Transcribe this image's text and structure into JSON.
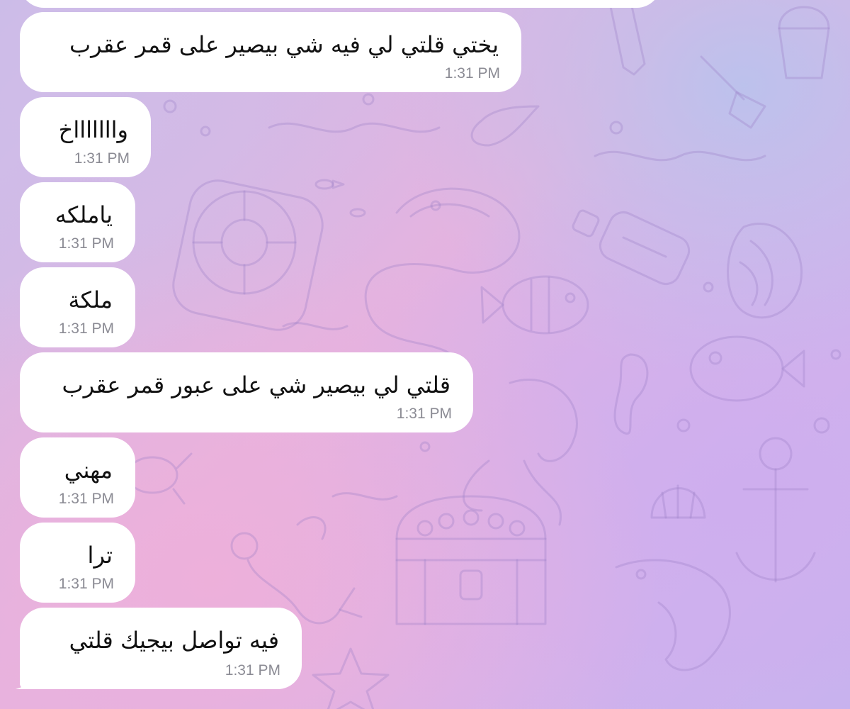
{
  "chat": {
    "messages": [
      {
        "text": "يختي قلتي لي فيه شي بيصير على قمر عقرب",
        "time": "1:31 PM"
      },
      {
        "text": "واااااااخ",
        "time": "1:31 PM"
      },
      {
        "text": "ياملكه",
        "time": "1:31 PM"
      },
      {
        "text": "ملكة",
        "time": "1:31 PM"
      },
      {
        "text": "قلتي لي بيصير شي على عبور قمر عقرب",
        "time": "1:31 PM"
      },
      {
        "text": "مهني",
        "time": "1:31 PM"
      },
      {
        "text": "ترا",
        "time": "1:31 PM"
      },
      {
        "text": "فيه تواصل بيجيك قلتي",
        "time": "1:31 PM"
      }
    ]
  },
  "colors": {
    "bubble": "#ffffff",
    "timestamp": "#8b8b94",
    "message_text": "#111111",
    "doodle_stroke": "#9b7fc6"
  }
}
